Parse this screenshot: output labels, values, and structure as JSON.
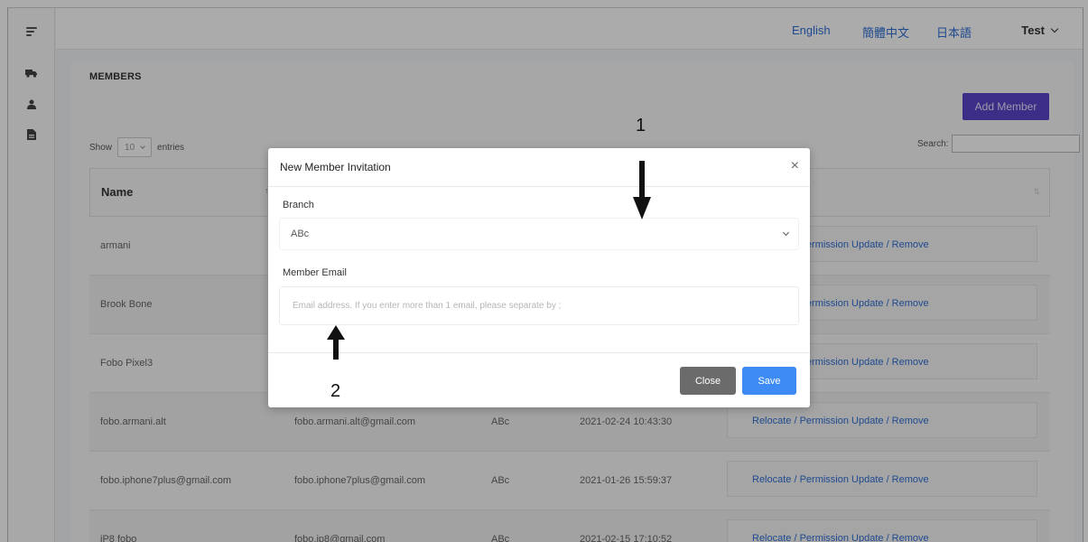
{
  "topbar": {
    "languages": [
      "English",
      "簡體中文",
      "日本語"
    ],
    "user": "Test"
  },
  "sidebar": {
    "icons": [
      "menu-icon",
      "truck-icon",
      "user-icon",
      "document-icon"
    ]
  },
  "page": {
    "title": "MEMBERS",
    "add_button": "Add Member",
    "show_label": "Show",
    "entries_value": "10",
    "entries_label": "entries",
    "search_label": "Search:"
  },
  "table": {
    "header_name": "Name",
    "rows": [
      {
        "name": "armani",
        "email": "",
        "branch": "",
        "date": "",
        "action": "Relocate / Permission Update / Remove"
      },
      {
        "name": "Brook Bone",
        "email": "",
        "branch": "",
        "date": "",
        "action": "Relocate / Permission Update / Remove"
      },
      {
        "name": "Fobo Pixel3",
        "email": "",
        "branch": "",
        "date": "",
        "action": "Relocate / Permission Update / Remove"
      },
      {
        "name": "fobo.armani.alt",
        "email": "fobo.armani.alt@gmail.com",
        "branch": "ABc",
        "date": "2021-02-24 10:43:30",
        "action": "Relocate / Permission Update / Remove"
      },
      {
        "name": "fobo.iphone7plus@gmail.com",
        "email": "fobo.iphone7plus@gmail.com",
        "branch": "ABc",
        "date": "2021-01-26 15:59:37",
        "action": "Relocate / Permission Update / Remove"
      },
      {
        "name": "iP8 fobo",
        "email": "fobo.ip8@gmail.com",
        "branch": "ABc",
        "date": "2021-02-15 17:10:52",
        "action": "Relocate / Permission Update / Remove"
      }
    ]
  },
  "modal": {
    "title": "New Member Invitation",
    "branch_label": "Branch",
    "branch_value": "ABc",
    "email_label": "Member Email",
    "email_placeholder": "Email address. If you enter more than 1 email, please separate by ;",
    "close_button": "Close",
    "save_button": "Save"
  },
  "annotations": {
    "marker_1": "1",
    "marker_2": "2"
  },
  "colors": {
    "accent_purple": "#5a43c9",
    "link_blue": "#2f6fd6",
    "save_blue": "#3e8bf5",
    "close_gray": "#6b6b6b"
  }
}
